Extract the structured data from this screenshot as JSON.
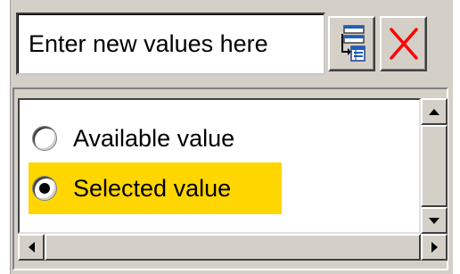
{
  "input": {
    "placeholder": "Enter new values here",
    "value": ""
  },
  "toolbar": {
    "add_icon": "add-to-list-icon",
    "clear_icon": "delete-x-icon",
    "clear_color": "#ff0000"
  },
  "list": {
    "items": [
      {
        "label": "Available value",
        "selected": false
      },
      {
        "label": "Selected value",
        "selected": true
      }
    ],
    "highlight_color": "#ffd600"
  },
  "icons": {
    "scroll_up": "arrow-up-icon",
    "scroll_down": "arrow-down-icon",
    "scroll_left": "arrow-left-icon",
    "scroll_right": "arrow-right-icon"
  }
}
